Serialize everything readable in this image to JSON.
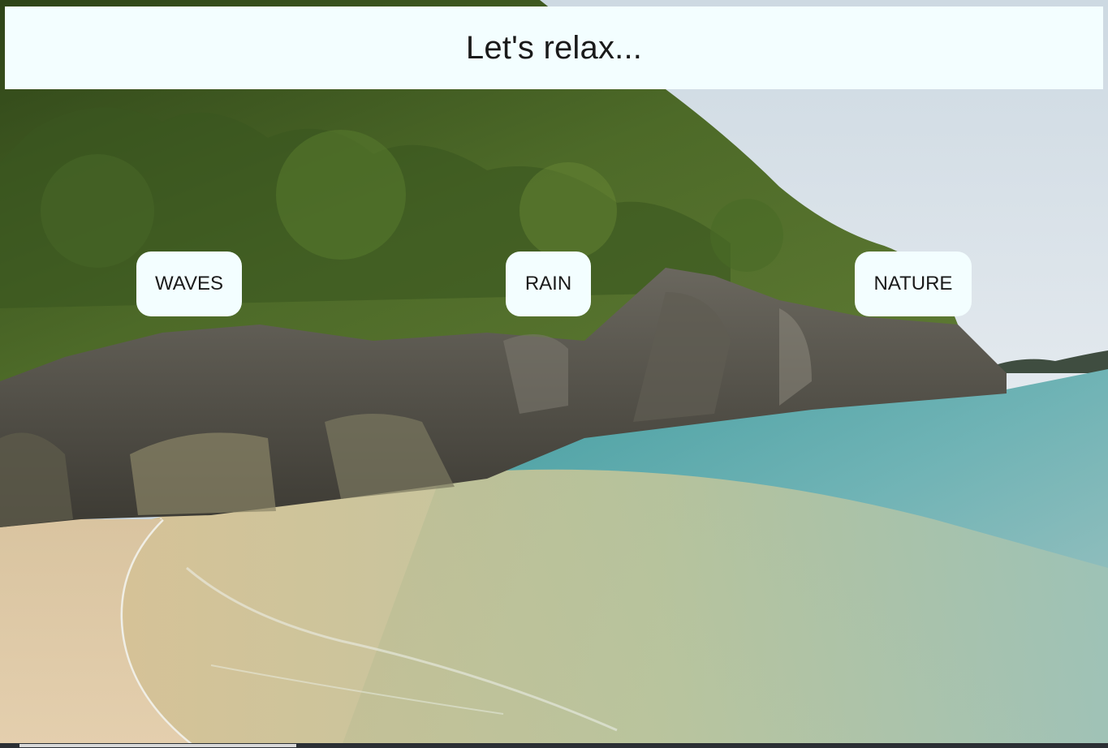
{
  "header": {
    "title": "Let's relax..."
  },
  "sounds": [
    {
      "label": "WAVES"
    },
    {
      "label": "RAIN"
    },
    {
      "label": "NATURE"
    }
  ],
  "background": {
    "scene": "tropical beach with rocky cliff, green trees and turquoise sea",
    "colors": {
      "sky": "#d5dfe6",
      "foliage": "#3f5a22",
      "rock": "#55534b",
      "sea": "#5fa8ad",
      "shallow_water": "#b9b88e",
      "sand": "#dcc7a5"
    }
  },
  "player": {
    "progress_fraction": 0.25
  }
}
